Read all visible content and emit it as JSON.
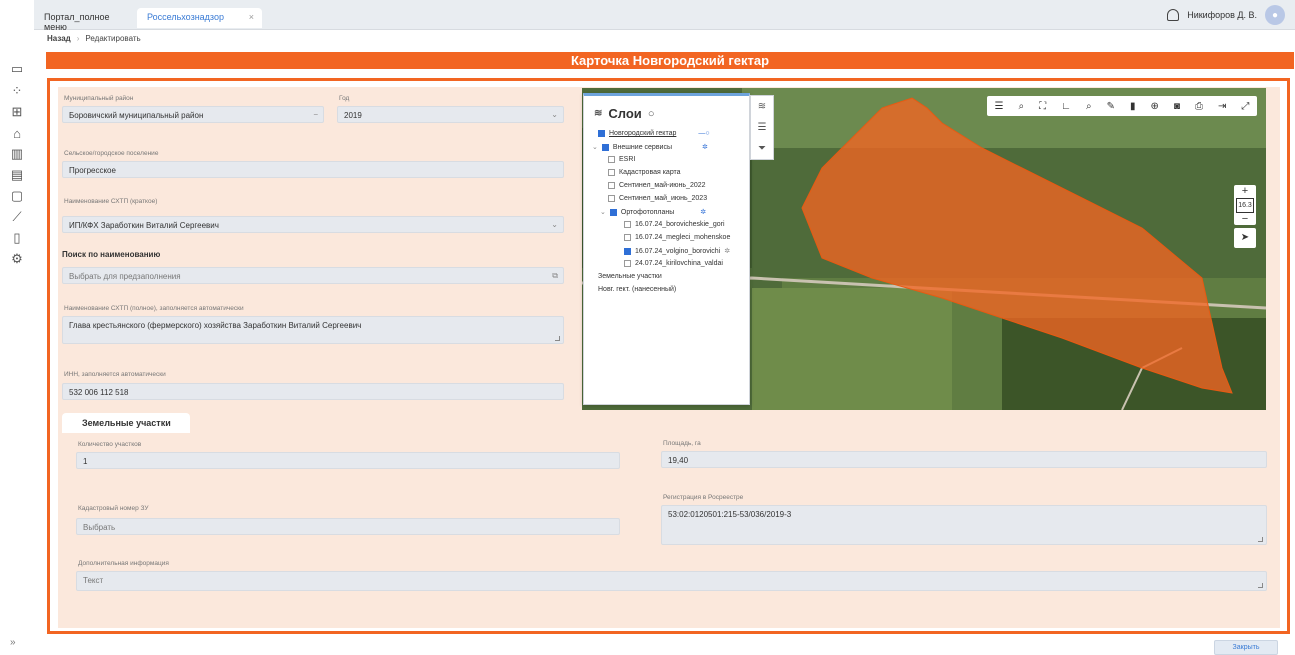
{
  "tabs": {
    "first": "Портал_полное меню",
    "second": "Россельхознадзор"
  },
  "user": {
    "name": "Никифоров Д. В."
  },
  "breadcrumb": {
    "back": "Назад",
    "current": "Редактировать"
  },
  "card_title": "Карточка Новгородский гектар",
  "form": {
    "district_label": "Муниципальный район",
    "district_value": "Боровичский муниципальный район",
    "year_label": "Год",
    "year_value": "2019",
    "settlement_label": "Сельское/городское поселение",
    "settlement_value": "Прогресское",
    "short_name_label": "Наименование СХТП (краткое)",
    "short_name_value": "ИП/КФХ Заработкин Виталий Сергеевич",
    "search_section": "Поиск по наименованию",
    "search_placeholder": "Выбрать для предзаполнения",
    "full_name_label": "Наименование СХТП (полное), заполняется автоматически",
    "full_name_value": "Глава крестьянского (фермерского) хозяйства Заработкин Виталий Сергеевич",
    "inn_label": "ИНН, заполняется автоматически",
    "inn_value": "532 006 112 518"
  },
  "land": {
    "tab_label": "Земельные участки",
    "count_label": "Количество участков",
    "count_value": "1",
    "area_label": "Площадь, га",
    "area_value": "19,40",
    "cadastral_label": "Кадастровый номер ЗУ",
    "cadastral_placeholder": "Выбрать",
    "registry_label": "Регистрация в Росреестре",
    "registry_value": "53:02:0120501:215-53/036/2019-3",
    "extra_label": "Дополнительная информация",
    "extra_placeholder": "Текст"
  },
  "layers": {
    "title": "Слои",
    "items": [
      {
        "label": "Новгородский гектар",
        "checked": true
      },
      {
        "label": "Внешние сервисы",
        "checked": true
      },
      {
        "label": "ESRI",
        "checked": false
      },
      {
        "label": "Кадастровая карта",
        "checked": false
      },
      {
        "label": "Сентинел_май-июнь_2022",
        "checked": false
      },
      {
        "label": "Сентинел_май_июнь_2023",
        "checked": false
      },
      {
        "label": "Ортофотопланы",
        "checked": true
      },
      {
        "label": "16.07.24_borovicheskie_gori",
        "checked": false
      },
      {
        "label": "16.07.24_megleci_mohenskoe",
        "checked": false
      },
      {
        "label": "16.07.24_volgino_borovichi",
        "checked": true
      },
      {
        "label": "24.07.24_kirilovchina_valdai",
        "checked": false
      },
      {
        "label": "Земельные участки",
        "checked": false
      },
      {
        "label": "Новг. гект. (нанесенный)",
        "checked": false
      }
    ]
  },
  "map": {
    "zoom_level": "16.3"
  },
  "close_button": "Закрыть",
  "colors": {
    "accent": "#f26522",
    "panel_bg": "#fbe8dc",
    "link": "#3a7bd5"
  }
}
